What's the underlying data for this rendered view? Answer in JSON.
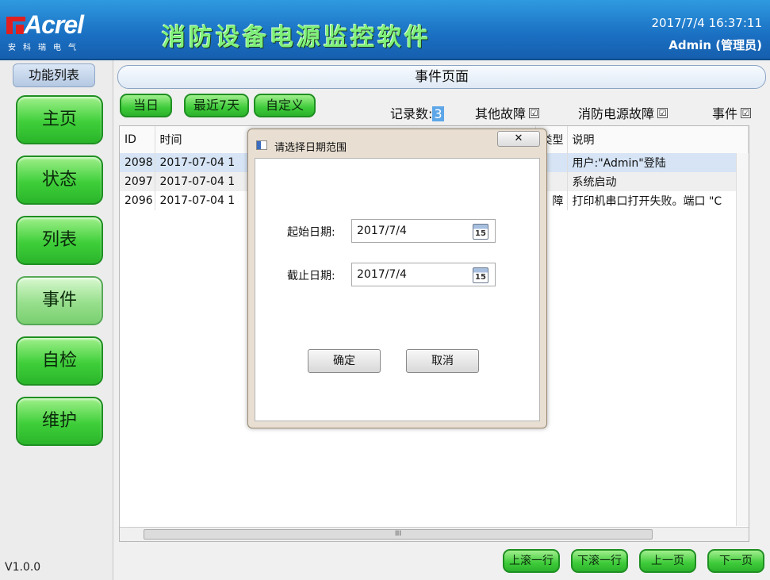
{
  "header": {
    "logo_brand": "Acrel",
    "logo_sub": "安科瑞电气",
    "app_title": "消防设备电源监控软件",
    "datetime": "2017/7/4 16:37:11",
    "user": "Admin (管理员)"
  },
  "sidebar": {
    "title": "功能列表",
    "items": [
      {
        "label": "主页"
      },
      {
        "label": "状态"
      },
      {
        "label": "列表"
      },
      {
        "label": "事件"
      },
      {
        "label": "自检"
      },
      {
        "label": "维护"
      }
    ],
    "active": "事件",
    "version": "V1.0.0"
  },
  "page": {
    "title": "事件页面"
  },
  "filters": {
    "today": "当日",
    "last7": "最近7天",
    "custom": "自定义",
    "record_label": "记录数:",
    "record_count": "3",
    "other_fault": "其他故障",
    "power_fault": "消防电源故障",
    "event": "事件",
    "check_mark": "☑"
  },
  "table": {
    "headers": {
      "id": "ID",
      "time": "时间",
      "type": "类型",
      "desc": "说明"
    },
    "rows": [
      {
        "id": "2098",
        "time": "2017-07-04 1",
        "type": "",
        "desc": "用户:\"Admin\"登陆"
      },
      {
        "id": "2097",
        "time": "2017-07-04 1",
        "type": "",
        "desc": "系统启动"
      },
      {
        "id": "2096",
        "time": "2017-07-04 1",
        "type": "障",
        "desc": "打印机串口打开失败。端口 \"C"
      }
    ],
    "scroll_grip": "III"
  },
  "dialog": {
    "title": "请选择日期范围",
    "close": "✕",
    "start_label": "起始日期:",
    "start_value": "2017/7/4",
    "end_label": "截止日期:",
    "end_value": "2017/7/4",
    "cal": "15",
    "ok": "确定",
    "cancel": "取消"
  },
  "pager": {
    "scroll_up": "上滚一行",
    "scroll_down": "下滚一行",
    "prev": "上一页",
    "next": "下一页"
  }
}
